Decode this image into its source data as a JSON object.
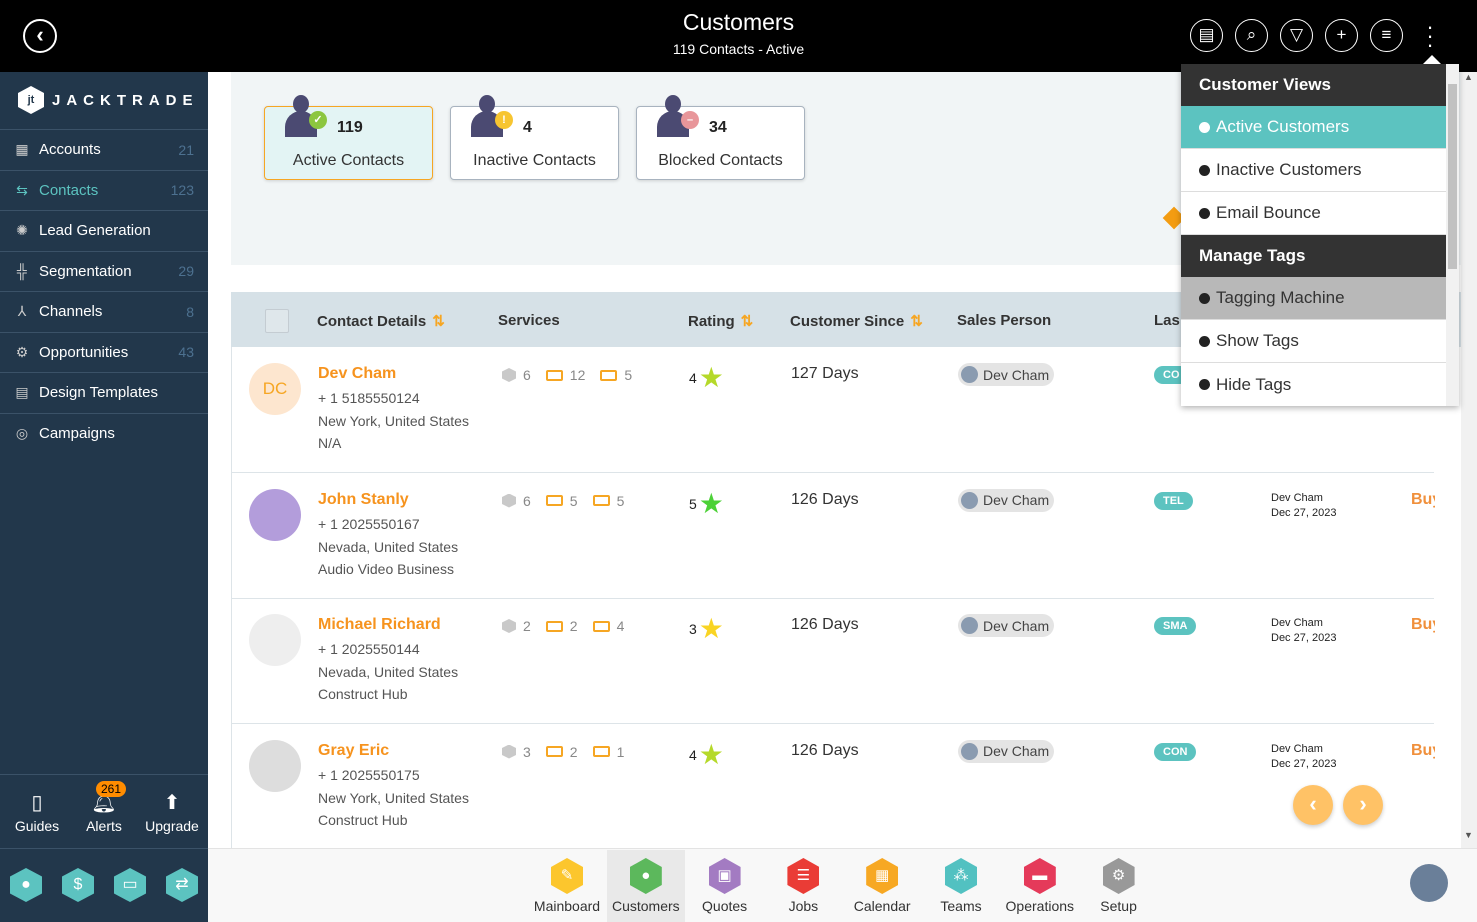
{
  "header": {
    "title": "Customers",
    "subtitle": "119 Contacts - Active",
    "icons": [
      "contact-card-icon",
      "search-icon",
      "filter-icon",
      "plus-icon",
      "list-icon",
      "kebab-icon"
    ]
  },
  "sidebar": {
    "logo": "JACKTRADE",
    "items": [
      {
        "label": "Accounts",
        "count": "21",
        "icon": "building-icon"
      },
      {
        "label": "Contacts",
        "count": "123",
        "icon": "contacts-icon",
        "active": true
      },
      {
        "label": "Lead Generation",
        "count": "",
        "icon": "lead-icon"
      },
      {
        "label": "Segmentation",
        "count": "29",
        "icon": "segmentation-icon"
      },
      {
        "label": "Channels",
        "count": "8",
        "icon": "channels-icon"
      },
      {
        "label": "Opportunities",
        "count": "43",
        "icon": "opportunities-icon"
      },
      {
        "label": "Design Templates",
        "count": "",
        "icon": "templates-icon"
      },
      {
        "label": "Campaigns",
        "count": "",
        "icon": "campaigns-icon"
      }
    ],
    "utilities": [
      {
        "label": "Guides"
      },
      {
        "label": "Alerts",
        "badge": "261"
      },
      {
        "label": "Upgrade"
      }
    ]
  },
  "stats": [
    {
      "count": "119",
      "label": "Active Contacts",
      "status": "active",
      "color": "#8cc63f"
    },
    {
      "count": "4",
      "label": "Inactive Contacts",
      "status": "inactive",
      "color": "#f7c531"
    },
    {
      "count": "34",
      "label": "Blocked Contacts",
      "status": "blocked",
      "color": "#e8969a"
    }
  ],
  "table": {
    "headers": [
      "Contact Details",
      "Services",
      "Rating",
      "Customer Since",
      "Sales Person",
      "Las"
    ],
    "rows": [
      {
        "initials": "DC",
        "name": "Dev Cham",
        "phone": "+ 1 5185550124",
        "location": "New York, United States",
        "company": "N/A",
        "services": [
          "6",
          "12",
          "5"
        ],
        "rating": "4",
        "star_color": "#b5d92a",
        "since": "127 Days",
        "sales": "Dev Cham",
        "tag": "CO",
        "last_by": "",
        "last_date": "",
        "buy": ""
      },
      {
        "initials": "",
        "name": "John Stanly",
        "phone": "+ 1 2025550167",
        "location": "Nevada, United States",
        "company": "Audio Video Business",
        "services": [
          "6",
          "5",
          "5"
        ],
        "rating": "5",
        "star_color": "#4cd137",
        "since": "126 Days",
        "sales": "Dev Cham",
        "tag": "TEL",
        "last_by": "Dev Cham",
        "last_date": "Dec 27, 2023",
        "buy": "Buy"
      },
      {
        "initials": "",
        "name": "Michael Richard",
        "phone": "+ 1 2025550144",
        "location": "Nevada, United States",
        "company": "Construct Hub",
        "services": [
          "2",
          "2",
          "4"
        ],
        "rating": "3",
        "star_color": "#f9d423",
        "since": "126 Days",
        "sales": "Dev Cham",
        "tag": "SMA",
        "last_by": "Dev Cham",
        "last_date": "Dec 27, 2023",
        "buy": "Buy"
      },
      {
        "initials": "",
        "name": "Gray Eric",
        "phone": "+ 1 2025550175",
        "location": "New York, United States",
        "company": "Construct Hub",
        "services": [
          "3",
          "2",
          "1"
        ],
        "rating": "4",
        "star_color": "#b5d92a",
        "since": "126 Days",
        "sales": "Dev Cham",
        "tag": "CON",
        "last_by": "Dev Cham",
        "last_date": "Dec 27, 2023",
        "buy": "Buy"
      }
    ]
  },
  "dropdown": {
    "section1": "Customer Views",
    "views": [
      "Active Customers",
      "Inactive Customers",
      "Email Bounce"
    ],
    "section2": "Manage Tags",
    "tags": [
      "Tagging Machine",
      "Show Tags",
      "Hide Tags"
    ]
  },
  "bottom_nav": [
    {
      "label": "Mainboard",
      "color": "#fcc62d"
    },
    {
      "label": "Customers",
      "color": "#5cb85c",
      "active": true
    },
    {
      "label": "Quotes",
      "color": "#a37bc2"
    },
    {
      "label": "Jobs",
      "color": "#ea3c36"
    },
    {
      "label": "Calendar",
      "color": "#f7a823"
    },
    {
      "label": "Teams",
      "color": "#52c1c1"
    },
    {
      "label": "Operations",
      "color": "#e53a5a"
    },
    {
      "label": "Setup",
      "color": "#999999"
    }
  ],
  "colors": {
    "accent": "#f6931e",
    "teal": "#5cc3c0",
    "sidebar": "#22374b"
  }
}
